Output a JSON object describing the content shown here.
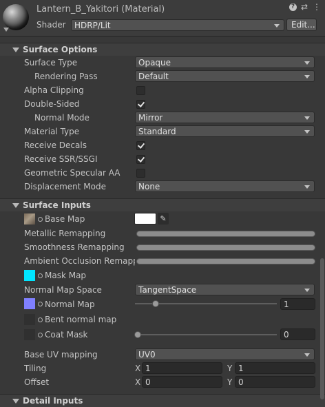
{
  "header": {
    "title": "Lantern_B_Yakitori (Material)",
    "shader_label": "Shader",
    "shader_value": "HDRP/Lit",
    "edit_button": "Edit..."
  },
  "surface_options": {
    "title": "Surface Options",
    "surface_type": {
      "label": "Surface Type",
      "value": "Opaque"
    },
    "rendering_pass": {
      "label": "Rendering Pass",
      "value": "Default"
    },
    "alpha_clipping": {
      "label": "Alpha Clipping",
      "checked": false
    },
    "double_sided": {
      "label": "Double-Sided",
      "checked": true
    },
    "normal_mode": {
      "label": "Normal Mode",
      "value": "Mirror"
    },
    "material_type": {
      "label": "Material Type",
      "value": "Standard"
    },
    "receive_decals": {
      "label": "Receive Decals",
      "checked": true
    },
    "receive_ssr": {
      "label": "Receive SSR/SSGI",
      "checked": true
    },
    "geometric_aa": {
      "label": "Geometric Specular AA",
      "checked": false
    },
    "displacement_mode": {
      "label": "Displacement Mode",
      "value": "None"
    }
  },
  "surface_inputs": {
    "title": "Surface Inputs",
    "base_map": {
      "label": "Base Map",
      "color": "#ffffff"
    },
    "metallic_remapping": "Metallic Remapping",
    "smoothness_remapping": "Smoothness Remapping",
    "ao_remapping": "Ambient Occlusion Remappin",
    "mask_map": {
      "label": "Mask Map",
      "tex_color": "#00e5ff"
    },
    "normal_map_space": {
      "label": "Normal Map Space",
      "value": "TangentSpace"
    },
    "normal_map": {
      "label": "Normal Map",
      "tex_color": "#8080ff",
      "value": "1"
    },
    "bent_normal_map": {
      "label": "Bent normal map"
    },
    "coat_mask": {
      "label": "Coat Mask",
      "value": "0"
    },
    "base_uv_mapping": {
      "label": "Base UV mapping",
      "value": "UV0"
    },
    "tiling": {
      "label": "Tiling",
      "x_label": "X",
      "x": "1",
      "y_label": "Y",
      "y": "1"
    },
    "offset": {
      "label": "Offset",
      "x_label": "X",
      "x": "0",
      "y_label": "Y",
      "y": "0"
    }
  },
  "detail_inputs": {
    "title": "Detail Inputs"
  }
}
